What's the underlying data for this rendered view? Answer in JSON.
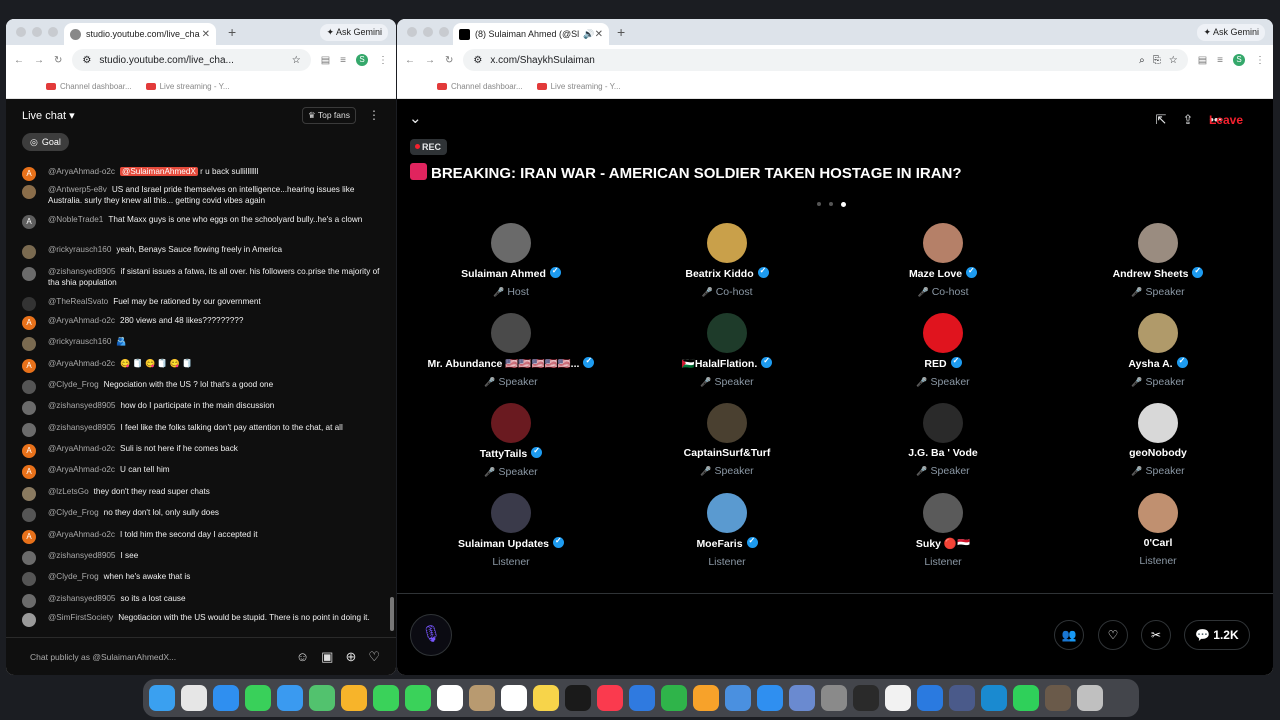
{
  "left_browser": {
    "tab_title": "studio.youtube.com/live_cha",
    "url": "studio.youtube.com/live_cha...",
    "ask_gemini": "Ask Gemini",
    "bookmarks": [
      "Channel dashboar...",
      "Live streaming - Y..."
    ],
    "profile_letter": "S"
  },
  "right_browser": {
    "tab_title": "(8) Sulaiman Ahmed (@Sl",
    "url": "x.com/ShaykhSulaiman",
    "ask_gemini": "Ask Gemini",
    "bookmarks": [
      "Channel dashboar...",
      "Live streaming - Y..."
    ],
    "profile_letter": "S"
  },
  "youtube_chat": {
    "header": "Live chat",
    "top_fans": "Top fans",
    "goal": "Goal",
    "input_placeholder": "Chat publicly as @SulaimanAhmedX...",
    "messages": [
      {
        "author": "@AryaAhmad-o2c",
        "mention": "@SulaimanAhmedX",
        "text": "r u back sullilllllll",
        "avatar_letter": "A",
        "avatar_color": "#e8711a"
      },
      {
        "author": "@Antwerp5-e8v",
        "mention": "",
        "text": "US and Israel pride themselves on intelligence...hearing issues like Australia. surly they knew all this... getting covid vibes again",
        "avatar_letter": "",
        "avatar_color": "#8a6d4a"
      },
      {
        "author": "@NobleTrade1",
        "mention": "",
        "text": "That Maxx guys is one who eggs on the schoolyard bully..he's a clown",
        "avatar_letter": "A",
        "avatar_color": "#5e5e5e"
      },
      {
        "author": "@rickyrausch160",
        "mention": "",
        "text": "yeah, Benays Sauce flowing freely in America",
        "avatar_letter": "",
        "avatar_color": "#7a6a50"
      },
      {
        "author": "@zishansyed8905",
        "mention": "",
        "text": "if sistani issues a fatwa, its all over. his followers co.prise the majority of tha shia population",
        "avatar_letter": "",
        "avatar_color": "#6b6b6b"
      },
      {
        "author": "@TheRealSvato",
        "mention": "",
        "text": "Fuel may be rationed by our government",
        "avatar_letter": "",
        "avatar_color": "#333333"
      },
      {
        "author": "@AryaAhmad-o2c",
        "mention": "",
        "text": "280 views and 48 likes?????????",
        "avatar_letter": "A",
        "avatar_color": "#e8711a"
      },
      {
        "author": "@rickyrausch160",
        "mention": "",
        "text": "🫂",
        "avatar_letter": "",
        "avatar_color": "#7a6a50"
      },
      {
        "author": "@AryaAhmad-o2c",
        "mention": "",
        "text": "😋 🧻 😋 🧻 😋 🧻",
        "avatar_letter": "A",
        "avatar_color": "#e8711a"
      },
      {
        "author": "@Clyde_Frog",
        "mention": "",
        "text": "Negociation with the US ? lol that's a good one",
        "avatar_letter": "",
        "avatar_color": "#555555"
      },
      {
        "author": "@zishansyed8905",
        "mention": "",
        "text": "how do I participate in the main discussion",
        "avatar_letter": "",
        "avatar_color": "#6b6b6b"
      },
      {
        "author": "@zishansyed8905",
        "mention": "",
        "text": "I feel like the folks talking don't pay attention to the chat, at all",
        "avatar_letter": "",
        "avatar_color": "#6b6b6b"
      },
      {
        "author": "@AryaAhmad-o2c",
        "mention": "",
        "text": "Suli is not here if he comes back",
        "avatar_letter": "A",
        "avatar_color": "#e8711a"
      },
      {
        "author": "@AryaAhmad-o2c",
        "mention": "",
        "text": "U can tell him",
        "avatar_letter": "A",
        "avatar_color": "#e8711a"
      },
      {
        "author": "@lzLetsGo",
        "mention": "",
        "text": "they don't they read super chats",
        "avatar_letter": "",
        "avatar_color": "#8a7a60"
      },
      {
        "author": "@Clyde_Frog",
        "mention": "",
        "text": "no they don't lol, only sully does",
        "avatar_letter": "",
        "avatar_color": "#555555"
      },
      {
        "author": "@AryaAhmad-o2c",
        "mention": "",
        "text": "I told him the second day I accepted it",
        "avatar_letter": "A",
        "avatar_color": "#e8711a"
      },
      {
        "author": "@zishansyed8905",
        "mention": "",
        "text": "I see",
        "avatar_letter": "",
        "avatar_color": "#6b6b6b"
      },
      {
        "author": "@Clyde_Frog",
        "mention": "",
        "text": "when he's awake that is",
        "avatar_letter": "",
        "avatar_color": "#555555"
      },
      {
        "author": "@zishansyed8905",
        "mention": "",
        "text": "so its a lost cause",
        "avatar_letter": "",
        "avatar_color": "#6b6b6b"
      },
      {
        "author": "@SimFirstSociety",
        "mention": "",
        "text": "Negotiacion with the US would be stupid. There is no point in doing it.",
        "avatar_letter": "",
        "avatar_color": "#9a9a9a"
      }
    ]
  },
  "space": {
    "rec": "REC",
    "leave": "Leave",
    "title": "BREAKING: IRAN WAR - AMERICAN SOLDIER TAKEN HOSTAGE IN IRAN?",
    "listener_count": "1.2K",
    "participants": [
      {
        "name": "Sulaiman Ahmed",
        "role": "Host",
        "verified": true,
        "mic": true,
        "color": "#6a6a6a"
      },
      {
        "name": "Beatrix Kiddo",
        "role": "Co-host",
        "verified": true,
        "mic": true,
        "color": "#c9a04a"
      },
      {
        "name": "Maze Love",
        "role": "Co-host",
        "verified": true,
        "mic": true,
        "color": "#b58068"
      },
      {
        "name": "Andrew Sheets",
        "role": "Speaker",
        "verified": true,
        "mic": true,
        "color": "#9a8c80"
      },
      {
        "name": "Mr. Abundance 🇺🇸🇺🇸🇺🇸🇺🇸🇺🇸...",
        "role": "Speaker",
        "verified": true,
        "mic": true,
        "color": "#4a4a4a"
      },
      {
        "name": "🇵🇸HalalFlation.",
        "role": "Speaker",
        "verified": true,
        "mic": true,
        "color": "#1e3b2a"
      },
      {
        "name": "RED",
        "role": "Speaker",
        "verified": true,
        "mic": true,
        "color": "#e0141e"
      },
      {
        "name": "Aysha A.",
        "role": "Speaker",
        "verified": true,
        "mic": true,
        "color": "#b09a6a"
      },
      {
        "name": "TattyTails",
        "role": "Speaker",
        "verified": true,
        "mic": true,
        "color": "#6a1a20"
      },
      {
        "name": "CaptainSurf&Turf",
        "role": "Speaker",
        "verified": false,
        "mic": true,
        "color": "#4a4030"
      },
      {
        "name": "J.G. Ba ' Vode",
        "role": "Speaker",
        "verified": false,
        "mic": true,
        "color": "#2a2a2a"
      },
      {
        "name": "geoNobody",
        "role": "Speaker",
        "verified": false,
        "mic": true,
        "color": "#d8d8d8"
      },
      {
        "name": "Sulaiman Updates",
        "role": "Listener",
        "verified": true,
        "mic": false,
        "color": "#3a3a4a"
      },
      {
        "name": "MoeFaris",
        "role": "Listener",
        "verified": true,
        "mic": false,
        "color": "#5a9ad0"
      },
      {
        "name": "Suky 🔴🇾🇪",
        "role": "Listener",
        "verified": false,
        "mic": false,
        "color": "#5a5a5a"
      },
      {
        "name": "0'Carl",
        "role": "Listener",
        "verified": false,
        "mic": false,
        "color": "#c09070"
      }
    ]
  },
  "dock": {
    "apps": [
      "finder-icon",
      "launchpad-icon",
      "safari-icon",
      "messages-icon",
      "mail-icon",
      "maps-icon",
      "photos-icon",
      "facetime-icon",
      "phone-icon",
      "calendar-icon",
      "contacts-icon",
      "reminders-icon",
      "notes-icon",
      "tv-icon",
      "music-icon",
      "keynote-icon",
      "numbers-icon",
      "pages-icon",
      "testflight-icon",
      "appstore-icon",
      "preview-icon",
      "settings-icon",
      "activity-icon",
      "chrome-icon",
      "safari-tech-icon",
      "finder2-icon",
      "quicktime-icon",
      "whatsapp-icon",
      "photobooth-icon",
      "trash-icon"
    ],
    "colors": [
      "#3aa0f0",
      "#e6e6e6",
      "#2f8ff0",
      "#39d05a",
      "#3a9af0",
      "#52c26e",
      "#f7b42a",
      "#3ad25a",
      "#3ad25a",
      "#ffffff",
      "#b89a70",
      "#ffffff",
      "#f7d44a",
      "#1a1a1a",
      "#fa3a4e",
      "#2f7ae0",
      "#2fb44a",
      "#f7a22a",
      "#4a90e0",
      "#2f8ff0",
      "#6a8ad0",
      "#8a8a8a",
      "#2a2a2a",
      "#f2f2f2",
      "#2a7ae0",
      "#4a5a8a",
      "#1a8ad0",
      "#2fd05a",
      "#6a5a4a",
      "#c0c0c0"
    ]
  }
}
